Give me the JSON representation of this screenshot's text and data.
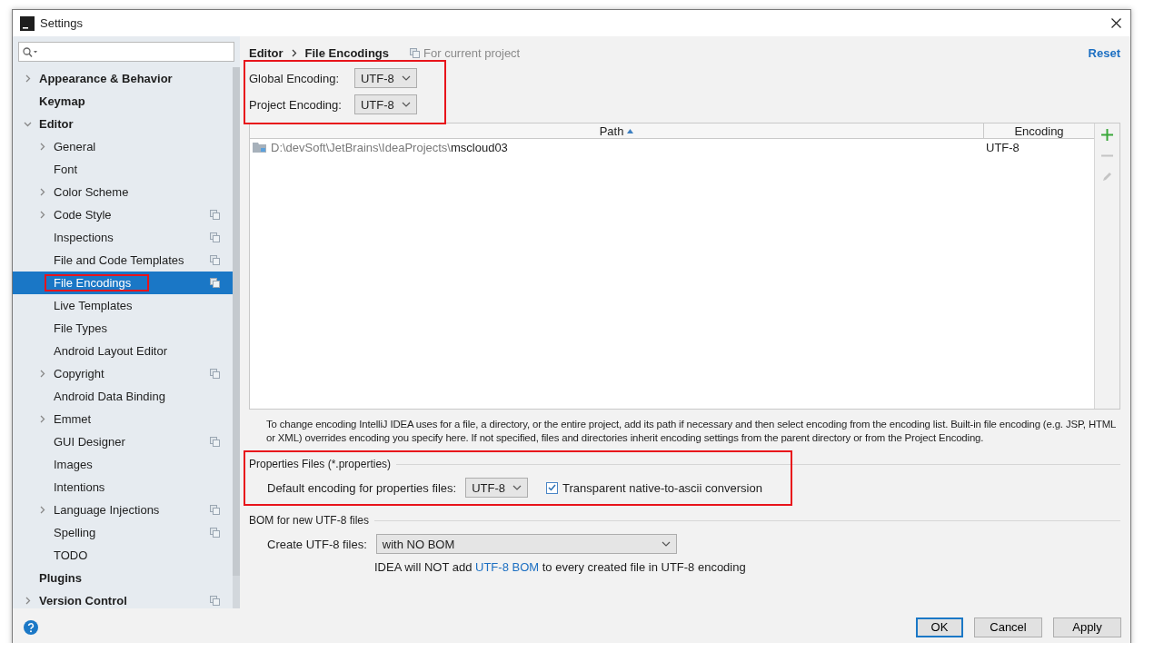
{
  "window": {
    "title": "Settings"
  },
  "sidebar": {
    "items": [
      {
        "label": "Appearance & Behavior",
        "expanded": false,
        "project_scope": false,
        "selected": false
      },
      {
        "label": "Keymap",
        "project_scope": false,
        "selected": false
      },
      {
        "label": "Editor",
        "expanded": true,
        "project_scope": false,
        "selected": false,
        "children": [
          {
            "label": "General",
            "expanded": false,
            "project_scope": false,
            "selected": false
          },
          {
            "label": "Font",
            "project_scope": false,
            "selected": false
          },
          {
            "label": "Color Scheme",
            "expanded": false,
            "project_scope": false,
            "selected": false
          },
          {
            "label": "Code Style",
            "expanded": false,
            "project_scope": true,
            "selected": false
          },
          {
            "label": "Inspections",
            "project_scope": true,
            "selected": false
          },
          {
            "label": "File and Code Templates",
            "project_scope": true,
            "selected": false
          },
          {
            "label": "File Encodings",
            "project_scope": true,
            "selected": true,
            "highlighted": true
          },
          {
            "label": "Live Templates",
            "project_scope": false,
            "selected": false
          },
          {
            "label": "File Types",
            "project_scope": false,
            "selected": false
          },
          {
            "label": "Android Layout Editor",
            "project_scope": false,
            "selected": false
          },
          {
            "label": "Copyright",
            "expanded": false,
            "project_scope": true,
            "selected": false
          },
          {
            "label": "Android Data Binding",
            "project_scope": false,
            "selected": false
          },
          {
            "label": "Emmet",
            "expanded": false,
            "project_scope": false,
            "selected": false
          },
          {
            "label": "GUI Designer",
            "project_scope": true,
            "selected": false
          },
          {
            "label": "Images",
            "project_scope": false,
            "selected": false
          },
          {
            "label": "Intentions",
            "project_scope": false,
            "selected": false
          },
          {
            "label": "Language Injections",
            "expanded": false,
            "project_scope": true,
            "selected": false
          },
          {
            "label": "Spelling",
            "project_scope": true,
            "selected": false
          },
          {
            "label": "TODO",
            "project_scope": false,
            "selected": false
          }
        ]
      },
      {
        "label": "Plugins",
        "project_scope": false,
        "selected": false
      },
      {
        "label": "Version Control",
        "expanded": false,
        "project_scope": true,
        "selected": false
      }
    ]
  },
  "header": {
    "breadcrumb": [
      "Editor",
      "File Encodings"
    ],
    "scope": "For current project",
    "reset": "Reset"
  },
  "encodings": {
    "highlighted": true,
    "rows": [
      {
        "label": "Global Encoding:",
        "value": "UTF-8"
      },
      {
        "label": "Project Encoding:",
        "value": "UTF-8"
      }
    ]
  },
  "table": {
    "columns": [
      "Path",
      "Encoding"
    ],
    "rows": [
      {
        "path": "D:\\devSoft\\JetBrains\\IdeaProjects\\**mscloud03**",
        "encoding": "UTF-8"
      }
    ],
    "tools": [
      {
        "kind": "add",
        "disabled": false
      },
      {
        "kind": "remove",
        "disabled": true
      },
      {
        "kind": "edit",
        "disabled": true
      }
    ]
  },
  "description": "To change encoding IntelliJ IDEA uses for a file, a directory, or the entire project, add its path if necessary and then select encoding from the encoding list. Built-in file encoding (e.g. JSP, HTML or XML) overrides encoding you specify here. If not specified, files and directories inherit encoding settings from the parent directory or from the Project Encoding.",
  "properties_files": {
    "title": "Properties Files (*.properties)",
    "highlighted": true,
    "label": "Default encoding for properties files:",
    "value": "UTF-8",
    "checkbox": {
      "label": "Transparent native-to-ascii conversion",
      "checked": true
    }
  },
  "bom": {
    "title": "BOM for new UTF-8 files",
    "label": "Create UTF-8 files:",
    "value": "with NO BOM",
    "note": {
      "before": "IDEA will NOT add ",
      "link": "UTF-8 BOM",
      "after": " to every created file in UTF-8 encoding"
    }
  },
  "buttons": [
    {
      "label": "OK",
      "default": true
    },
    {
      "label": "Cancel",
      "default": false
    },
    {
      "label": "Apply",
      "default": false
    }
  ]
}
